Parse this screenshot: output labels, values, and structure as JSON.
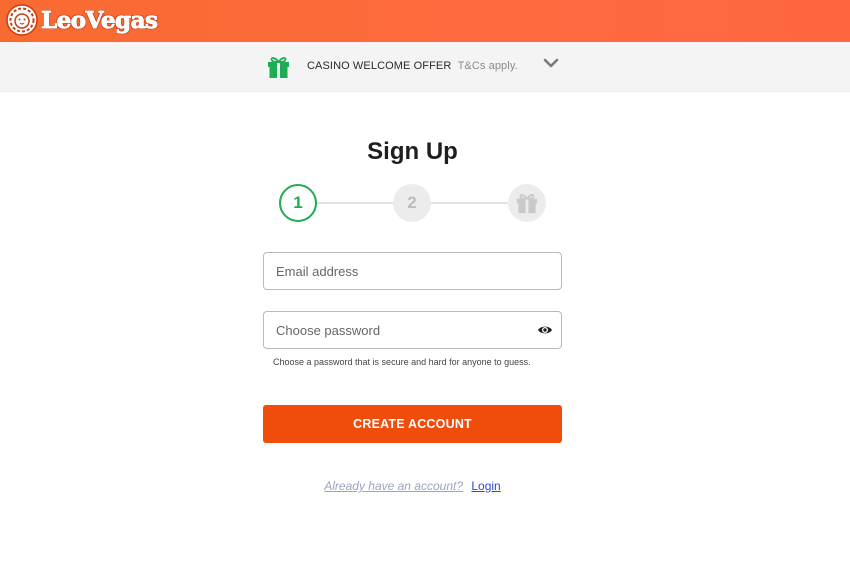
{
  "header": {
    "brand": "LeoVegas"
  },
  "offer_bar": {
    "title": "CASINO WELCOME OFFER",
    "terms": "T&Cs apply.",
    "gift_icon": "gift-icon",
    "expand_icon": "chevron-down-icon"
  },
  "signup": {
    "title": "Sign Up",
    "steps": [
      "1",
      "2"
    ],
    "final_step_icon": "gift-icon",
    "email_placeholder": "Email address",
    "password_placeholder": "Choose password",
    "password_hint": "Choose a password that is secure and hard for anyone to guess.",
    "submit_label": "CREATE ACCOUNT",
    "already_text": "Already have an account?",
    "login_label": "Login"
  },
  "colors": {
    "header_accent": "#ff6a3f",
    "primary_button": "#f04d0c",
    "step_active": "#1eac55",
    "link": "#2c4bd0"
  }
}
